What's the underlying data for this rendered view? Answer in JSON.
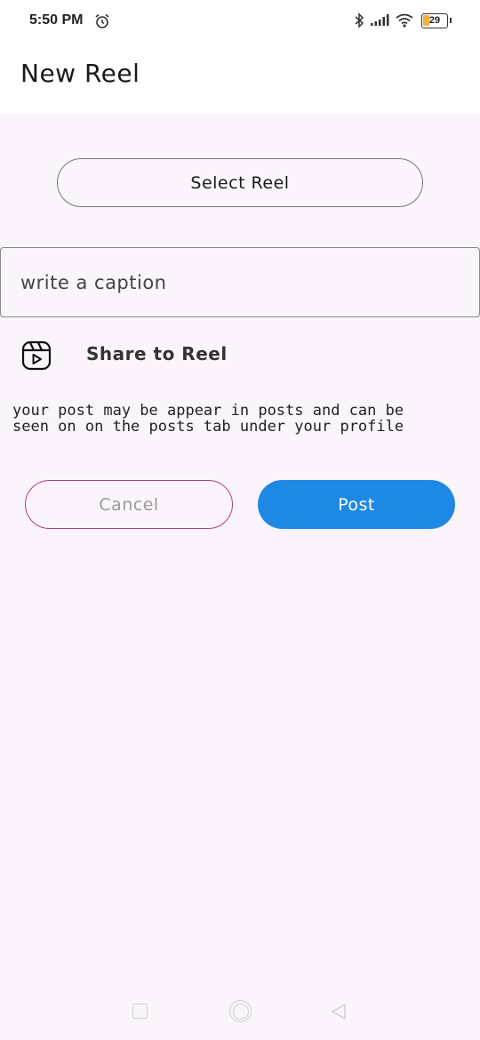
{
  "status_bar": {
    "time": "5:50 PM",
    "battery_level": "29",
    "battery_fraction": 0.29,
    "icons": [
      "alarm-icon",
      "bluetooth-icon",
      "signal-icon",
      "wifi-icon",
      "battery-icon"
    ]
  },
  "app_bar": {
    "title": "New Reel"
  },
  "main": {
    "select_reel_label": "Select Reel",
    "caption_placeholder": "write a caption",
    "caption_value": "",
    "share_icon": "reel-icon",
    "share_label": "Share to Reel",
    "info_line1": "your post may be appear in posts and can be",
    "info_line2": "seen on on the posts tab under your profile",
    "cancel_label": "Cancel",
    "post_label": "Post"
  },
  "colors": {
    "background": "#fcf4fc",
    "post_button": "#1e88e5",
    "cancel_border": "#b0407a",
    "battery_fill": "#f2b233"
  },
  "nav_bar": {
    "icons": [
      "recents-icon",
      "home-icon",
      "back-icon"
    ]
  }
}
